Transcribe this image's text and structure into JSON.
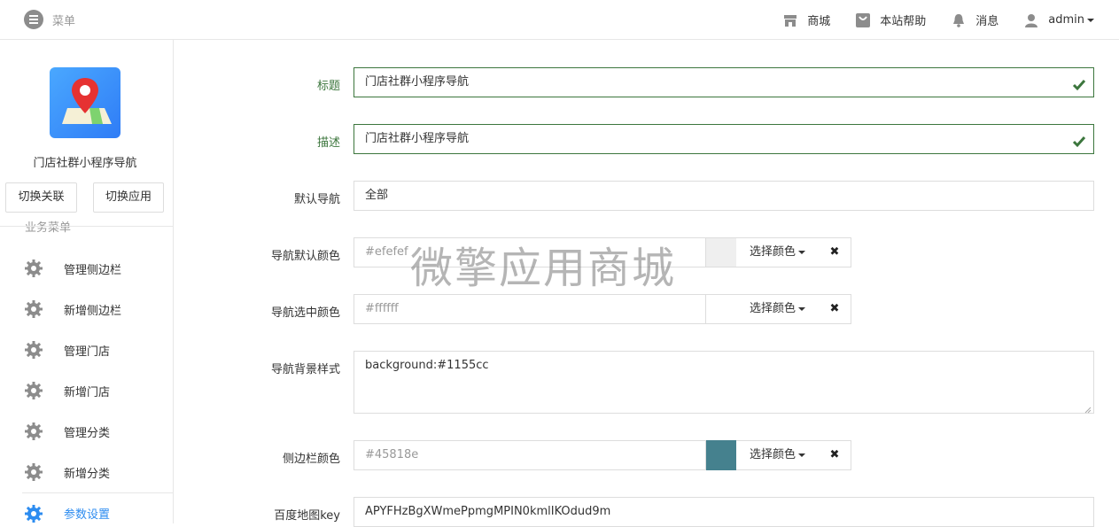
{
  "topbar": {
    "menu_label": "菜单",
    "links": [
      {
        "icon": "store-icon",
        "label": "商城"
      },
      {
        "icon": "help-bag-icon",
        "label": "本站帮助"
      },
      {
        "icon": "bell-icon",
        "label": "消息"
      },
      {
        "icon": "user-icon",
        "label": "admin"
      }
    ]
  },
  "sidebar": {
    "app_name": "门店社群小程序导航",
    "switch_relation": "切换关联",
    "switch_app": "切换应用",
    "group_title": "业务菜单",
    "items": [
      {
        "label": "管理侧边栏",
        "icon": "gear-icon"
      },
      {
        "label": "新增侧边栏",
        "icon": "gear-icon"
      },
      {
        "label": "管理门店",
        "icon": "gear-icon"
      },
      {
        "label": "新增门店",
        "icon": "gear-icon"
      },
      {
        "label": "管理分类",
        "icon": "gear-icon"
      },
      {
        "label": "新增分类",
        "icon": "gear-icon"
      },
      {
        "label": "参数设置",
        "icon": "gear-icon",
        "active": true
      }
    ]
  },
  "form": {
    "title_label": "标题",
    "title_value": "门店社群小程序导航",
    "desc_label": "描述",
    "desc_value": "门店社群小程序导航",
    "default_nav_label": "默认导航",
    "default_nav_value": "全部",
    "nav_default_color_label": "导航默认颜色",
    "nav_default_color_value": "#efefef",
    "nav_selected_color_label": "导航选中颜色",
    "nav_selected_color_value": "#ffffff",
    "nav_bg_style_label": "导航背景样式",
    "nav_bg_style_value": "background:#1155cc",
    "sidebar_color_label": "侧边栏颜色",
    "sidebar_color_value": "#45818e",
    "baidu_key_label": "百度地图key",
    "baidu_key_value": "APYFHzBgXWmePpmgMPIN0kmlIKOdud9m",
    "pick_color_label": "选择颜色",
    "clear_label": "✖"
  },
  "watermark": "微擎应用商城",
  "colors": {
    "ok_green": "#3c763d",
    "active_blue": "#2d8cf0",
    "swatch_default": "#efefef",
    "swatch_selected": "#ffffff",
    "swatch_sidebar": "#45818e"
  }
}
